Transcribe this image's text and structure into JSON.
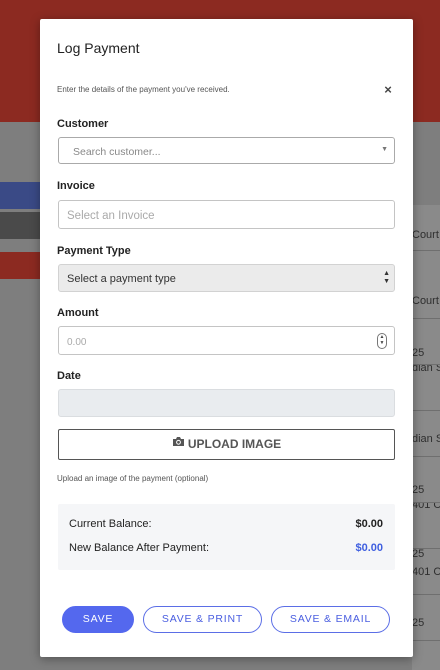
{
  "background": {
    "rows": [
      "Court",
      "",
      "Court",
      "25",
      "dian S",
      "",
      "dian S",
      "25",
      "401 Co",
      "25",
      "401 Co",
      "25"
    ]
  },
  "modal": {
    "title": "Log Payment",
    "description": "Enter the details of the payment you've received.",
    "close_label": "×",
    "customer": {
      "label": "Customer",
      "placeholder": "Search customer..."
    },
    "invoice": {
      "label": "Invoice",
      "placeholder": "Select an Invoice"
    },
    "payment_type": {
      "label": "Payment Type",
      "selected": "Select a payment type"
    },
    "amount": {
      "label": "Amount",
      "placeholder": "0.00"
    },
    "date": {
      "label": "Date",
      "value": ""
    },
    "upload": {
      "label": "UPLOAD IMAGE",
      "hint": "Upload an image of the payment (optional)"
    },
    "summary": {
      "current_balance_label": "Current Balance:",
      "current_balance_value": "$0.00",
      "new_balance_label": "New Balance After Payment:",
      "new_balance_value": "$0.00"
    },
    "buttons": {
      "save": "SAVE",
      "save_print": "SAVE & PRINT",
      "save_email": "SAVE & EMAIL"
    }
  },
  "colors": {
    "accent": "#5468ee",
    "header": "#8c2a21"
  }
}
